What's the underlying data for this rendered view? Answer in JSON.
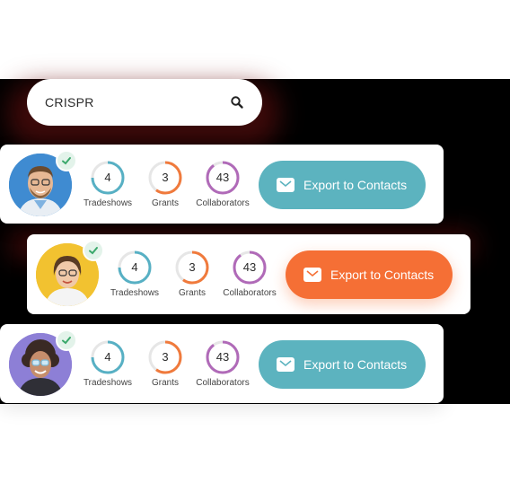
{
  "search": {
    "query": "CRISPR",
    "icon": "search-icon"
  },
  "labels": {
    "tradeshows": "Tradeshows",
    "grants": "Grants",
    "collaborators": "Collaborators"
  },
  "colors": {
    "teal": "#5cb3bf",
    "orange": "#f56f35",
    "ring_blue": "#57b0c4",
    "ring_orange": "#f07a3c",
    "ring_purple": "#b06ab8"
  },
  "contacts": [
    {
      "name_icon": "avatar-man-glasses",
      "verified": true,
      "tradeshows": "4",
      "grants": "3",
      "collaborators": "43",
      "export_label": "Export to Contacts",
      "highlighted": false
    },
    {
      "name_icon": "avatar-woman-glasses",
      "verified": true,
      "tradeshows": "4",
      "grants": "3",
      "collaborators": "43",
      "export_label": "Export to Contacts",
      "highlighted": true
    },
    {
      "name_icon": "avatar-woman-curly-hair",
      "verified": true,
      "tradeshows": "4",
      "grants": "3",
      "collaborators": "43",
      "export_label": "Export to Contacts",
      "highlighted": false
    }
  ]
}
